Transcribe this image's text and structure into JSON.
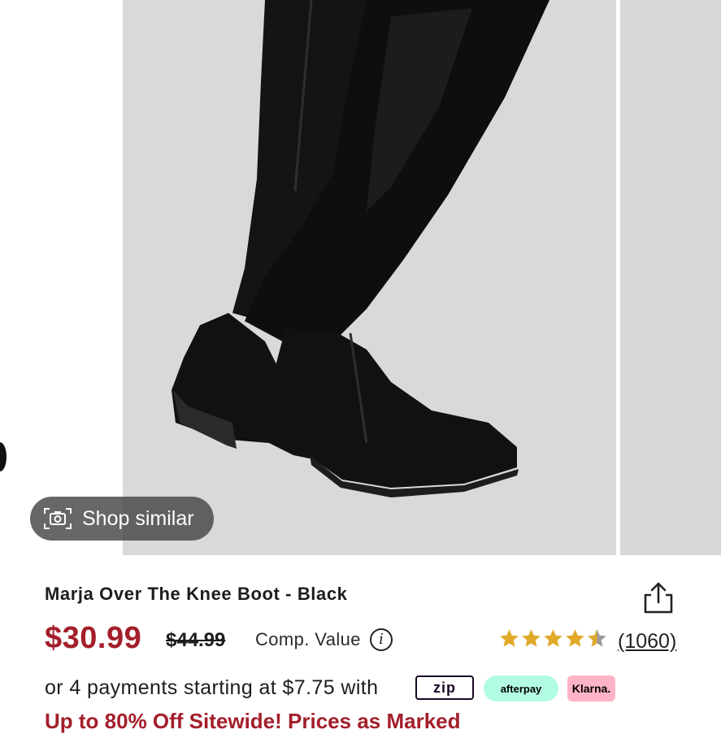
{
  "product": {
    "title": "Marja Over The Knee Boot - Black",
    "price": "$30.99",
    "original_price": "$44.99",
    "comp_label": "Comp. Value",
    "info_glyph": "i",
    "rating": 4.5,
    "reviews": "(1060)",
    "payments_text": "or 4 payments starting at $7.75 with",
    "promo_text": "Up to 80% Off Sitewide! Prices as Marked"
  },
  "gallery": {
    "shop_similar_label": "Shop similar"
  },
  "payment_providers": {
    "zip": "zip",
    "afterpay": "afterpay",
    "klarna": "Klarna."
  },
  "colors": {
    "price_red": "#a31f2b",
    "star_gold": "#e0a92a",
    "star_gray": "#9a9a9a",
    "afterpay_mint": "#b2fce4",
    "klarna_pink": "#ffb3c7"
  },
  "icons": {
    "camera": "camera-icon",
    "share": "share-icon",
    "info": "info-icon",
    "star": "star-icon"
  }
}
